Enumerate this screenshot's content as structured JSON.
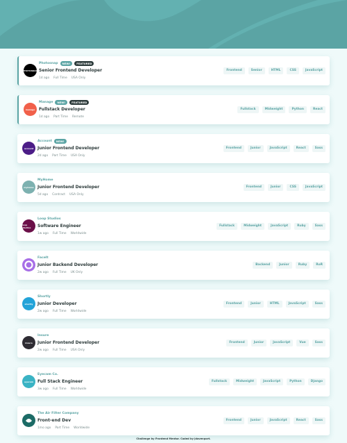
{
  "colors": {
    "primary": "#5ba4a4",
    "dark": "#2c3a3a",
    "bg": "#effafa"
  },
  "badges": {
    "new": "NEW!",
    "featured": "FEATURED"
  },
  "jobs": [
    {
      "company": "Photosnap",
      "logo_text": "PHOTOSNAP",
      "logo_color": "#000000",
      "new": true,
      "featured": true,
      "position": "Senior Frontend Developer",
      "posted": "1d ago",
      "contract": "Full Time",
      "location": "USA Only",
      "tags": [
        "Frontend",
        "Senior",
        "HTML",
        "CSS",
        "JavaScript"
      ]
    },
    {
      "company": "Manage",
      "logo_text": "manage",
      "logo_color": "#f1604a",
      "new": true,
      "featured": true,
      "position": "Fullstack Developer",
      "posted": "1d ago",
      "contract": "Part Time",
      "location": "Remote",
      "tags": [
        "Fullstack",
        "Midweight",
        "Python",
        "React"
      ]
    },
    {
      "company": "Account",
      "logo_text": "account",
      "logo_color": "#4c1d87",
      "new": true,
      "featured": false,
      "position": "Junior Frontend Developer",
      "posted": "2d ago",
      "contract": "Part Time",
      "location": "USA Only",
      "tags": [
        "Frontend",
        "Junior",
        "JavaScript",
        "React",
        "Sass"
      ]
    },
    {
      "company": "MyHome",
      "logo_text": "myhome",
      "logo_color": "#7db1b0",
      "new": false,
      "featured": false,
      "position": "Junior Frontend Developer",
      "posted": "5d ago",
      "contract": "Contract",
      "location": "USA Only",
      "tags": [
        "Frontend",
        "Junior",
        "CSS",
        "JavaScript"
      ]
    },
    {
      "company": "Loop Studios",
      "logo_text": "loop studios",
      "logo_color": "#6b0f48",
      "new": false,
      "featured": false,
      "position": "Software Engineer",
      "posted": "1w ago",
      "contract": "Full Time",
      "location": "Worldwide",
      "tags": [
        "Fullstack",
        "Midweight",
        "JavaScript",
        "Ruby",
        "Sass"
      ]
    },
    {
      "company": "FaceIt",
      "logo_text": "",
      "logo_color": "#a76ee6",
      "new": false,
      "featured": false,
      "position": "Junior Backend Developer",
      "posted": "2w ago",
      "contract": "Full Time",
      "location": "UK Only",
      "tags": [
        "Backend",
        "Junior",
        "Ruby",
        "RoR"
      ]
    },
    {
      "company": "Shortly",
      "logo_text": "shortly",
      "logo_color": "#23a3d8",
      "new": false,
      "featured": false,
      "position": "Junior Developer",
      "posted": "2w ago",
      "contract": "Full Time",
      "location": "Worldwide",
      "tags": [
        "Frontend",
        "Junior",
        "HTML",
        "JavaScript",
        "Sass"
      ]
    },
    {
      "company": "Insure",
      "logo_text": "insure",
      "logo_color": "#2e2c33",
      "new": false,
      "featured": false,
      "position": "Junior Frontend Developer",
      "posted": "2w ago",
      "contract": "Full Time",
      "location": "USA Only",
      "tags": [
        "Frontend",
        "Junior",
        "JavaScript",
        "Vue",
        "Sass"
      ]
    },
    {
      "company": "Eyecam Co.",
      "logo_text": "eyecam",
      "logo_color": "#3ab3c4",
      "new": false,
      "featured": false,
      "position": "Full Stack Engineer",
      "posted": "3w ago",
      "contract": "Full Time",
      "location": "Worldwide",
      "tags": [
        "Fullstack",
        "Midweight",
        "JavaScript",
        "Python",
        "Django"
      ]
    },
    {
      "company": "The Air Filter Company",
      "logo_text": "",
      "logo_color": "#1c6b66",
      "new": false,
      "featured": false,
      "position": "Front-end Dev",
      "posted": "1mo ago",
      "contract": "Part Time",
      "location": "Worldwide",
      "tags": [
        "Frontend",
        "Junior",
        "JavaScript",
        "React",
        "Sass"
      ]
    }
  ],
  "footer": "Challenge by Frontend Mentor. Coded by jdavenport."
}
